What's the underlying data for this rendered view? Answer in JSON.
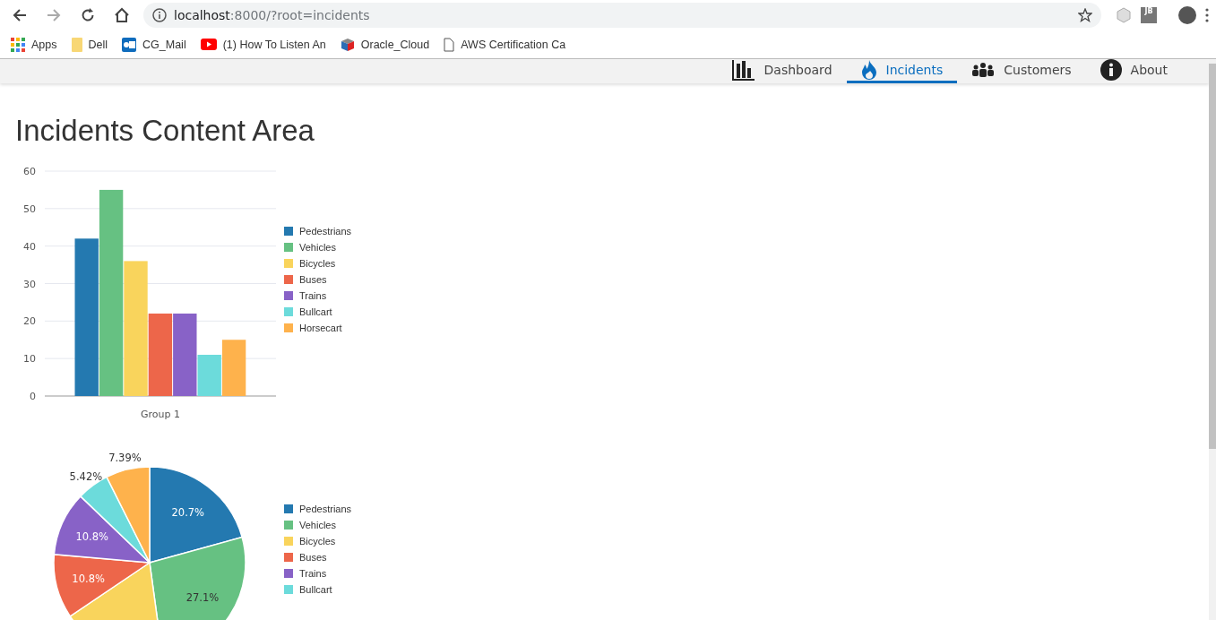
{
  "browser": {
    "url_host": "localhost",
    "url_rest": ":8000/?root=incidents",
    "extension_label": "JB",
    "bookmarks": [
      "Apps",
      "Dell",
      "CG_Mail",
      "(1) How To Listen An",
      "Oracle_Cloud",
      "AWS Certification Ca"
    ]
  },
  "nav": {
    "items": [
      {
        "label": "Dashboard",
        "selected": false
      },
      {
        "label": "Incidents",
        "selected": true
      },
      {
        "label": "Customers",
        "selected": false
      },
      {
        "label": "About",
        "selected": false
      }
    ]
  },
  "page": {
    "title": "Incidents Content Area"
  },
  "bar_chart": {
    "chart_data": {
      "type": "bar",
      "grid": true,
      "categories": [
        "Group 1"
      ],
      "ylim": [
        0,
        60
      ],
      "yticks": [
        0,
        10,
        20,
        30,
        40,
        50,
        60
      ],
      "series": [
        {
          "name": "Pedestrians",
          "color": "#2479b0",
          "values": [
            42
          ]
        },
        {
          "name": "Vehicles",
          "color": "#66c182",
          "values": [
            55
          ]
        },
        {
          "name": "Bicycles",
          "color": "#f9d45c",
          "values": [
            36
          ]
        },
        {
          "name": "Buses",
          "color": "#ed664a",
          "values": [
            22
          ]
        },
        {
          "name": "Trains",
          "color": "#8862c7",
          "values": [
            22
          ]
        },
        {
          "name": "Bullcart",
          "color": "#6cdbdb",
          "values": [
            11
          ]
        },
        {
          "name": "Horsecart",
          "color": "#feb24c",
          "values": [
            15
          ]
        }
      ]
    }
  },
  "pie_chart": {
    "chart_data": {
      "type": "pie",
      "series": [
        {
          "values": [
            20.7,
            27.1,
            17.7,
            10.8,
            10.8,
            5.42,
            7.39
          ]
        }
      ],
      "colors": [
        "#2479b0",
        "#66c182",
        "#f9d45c",
        "#ed664a",
        "#8862c7",
        "#6cdbdb",
        "#feb24c"
      ],
      "value_labels": [
        "20.7%",
        "27.1%",
        null,
        "10.8%",
        "10.8%",
        "5.42%",
        "7.39%"
      ]
    },
    "legend": [
      "Pedestrians",
      "Vehicles",
      "Bicycles",
      "Buses",
      "Trains",
      "Bullcart"
    ]
  }
}
